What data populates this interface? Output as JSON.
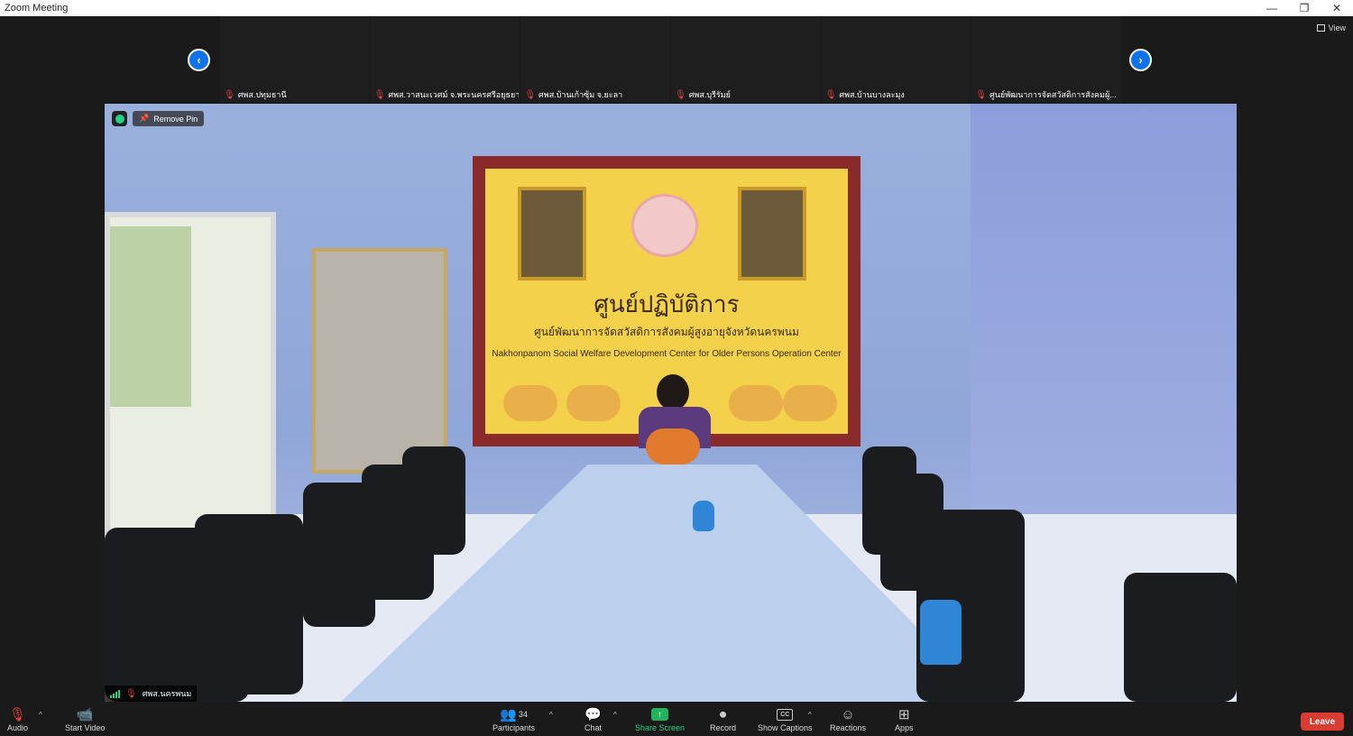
{
  "window": {
    "title": "Zoom Meeting",
    "minimize": "—",
    "restore": "❐",
    "close": "✕"
  },
  "thumbnails": [
    {
      "name": "ศพส.ปทุมธานี"
    },
    {
      "name": "ศพส.วาสนะเวศม์ จ.พระนครศรีอยุธยา"
    },
    {
      "name": "ศพส.บ้านเก้าซุ้ม จ.ยะลา"
    },
    {
      "name": "ศพส.บุรีรัมย์"
    },
    {
      "name": "ศพส.บ้านบางละมุง"
    },
    {
      "name": "ศูนย์พัฒนาการจัดสวัสดิการสังคมผู้..."
    }
  ],
  "view_label": "View",
  "pinned": {
    "remove_pin": "Remove Pin",
    "name": "ศพส.นครพนม"
  },
  "board": {
    "title": "ศูนย์ปฏิบัติการ",
    "subtitle": "ศูนย์พัฒนาการจัดสวัสดิการสังคมผู้สูงอายุจังหวัดนครพนม",
    "english": "Nakhonpanom Social Welfare Development Center for Older Persons Operation Center"
  },
  "toolbar": {
    "audio": "Audio",
    "start_video": "Start Video",
    "participants": "Participants",
    "participants_count": "34",
    "chat": "Chat",
    "share_screen": "Share Screen",
    "record": "Record",
    "show_captions": "Show Captions",
    "reactions": "Reactions",
    "apps": "Apps",
    "leave": "Leave"
  },
  "colors": {
    "accent": "#0e72ed",
    "leave": "#d93c31",
    "share": "#23b35a"
  }
}
